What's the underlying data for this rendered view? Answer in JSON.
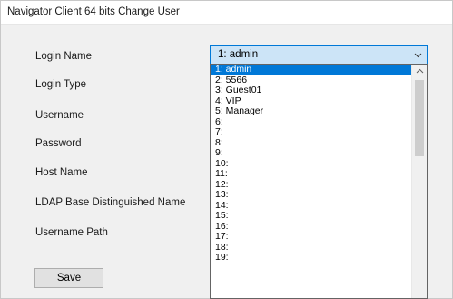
{
  "window": {
    "title": "Navigator Client 64 bits Change User"
  },
  "form": {
    "labels": {
      "login_name": "Login Name",
      "login_type": "Login Type",
      "username": "Username",
      "password": "Password",
      "host_name": "Host Name",
      "ldap_base_dn": "LDAP Base Distinguished Name",
      "username_path": "Username Path"
    },
    "save_label": "Save"
  },
  "login_combo": {
    "selected_value": "1: admin",
    "arrow_icon": "chevron-down-icon",
    "options": [
      "1: admin",
      "2: 5566",
      "3: Guest01",
      "4: VIP",
      "5: Manager",
      "6:",
      "7:",
      "8:",
      "9:",
      "10:",
      "11:",
      "12:",
      "13:",
      "14:",
      "15:",
      "16:",
      "17:",
      "18:",
      "19:"
    ],
    "selected_index": 0
  },
  "colors": {
    "selection": "#0078d7",
    "combo_background": "#cce4f7",
    "dialog_background": "#f0f0f0"
  }
}
